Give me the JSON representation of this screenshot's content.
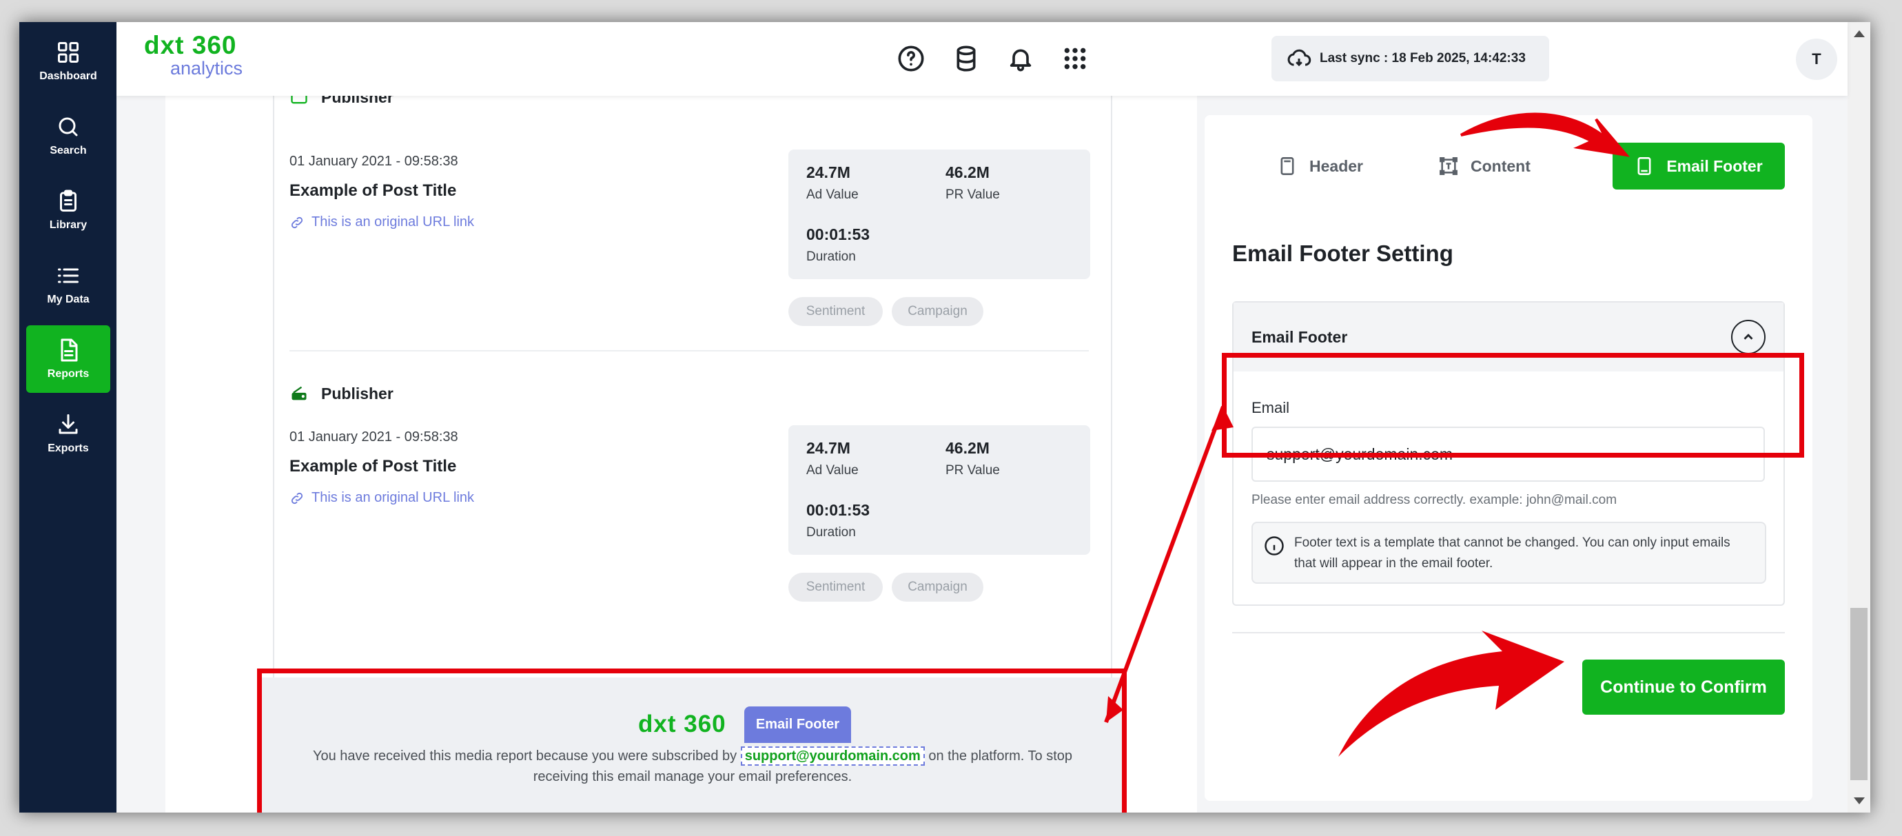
{
  "sidebar": {
    "items": [
      {
        "label": "Dashboard",
        "icon": "grid-icon"
      },
      {
        "label": "Search",
        "icon": "search-icon"
      },
      {
        "label": "Library",
        "icon": "clipboard-icon"
      },
      {
        "label": "My Data",
        "icon": "list-icon"
      },
      {
        "label": "Reports",
        "icon": "report-icon",
        "active": true
      },
      {
        "label": "Exports",
        "icon": "download-icon"
      }
    ]
  },
  "header": {
    "logo_brand": "dxt 360",
    "logo_sub": "analytics",
    "sync": "Last sync : 18 Feb 2025, 14:42:33",
    "avatar": "T",
    "icons": [
      "help-icon",
      "database-icon",
      "bell-icon",
      "apps-icon"
    ]
  },
  "preview": {
    "posts": [
      {
        "publisher": "Publisher",
        "date": "01 January 2021 - 09:58:38",
        "title": "Example of Post Title",
        "link": "This is an original URL link",
        "ad_value": "24.7M",
        "ad_label": "Ad Value",
        "pr_value": "46.2M",
        "pr_label": "PR Value",
        "duration": "00:01:53",
        "duration_label": "Duration",
        "tags": [
          "Sentiment",
          "Campaign"
        ]
      },
      {
        "publisher": "Publisher",
        "date": "01 January 2021 - 09:58:38",
        "title": "Example of Post Title",
        "link": "This is an original URL link",
        "ad_value": "24.7M",
        "ad_label": "Ad Value",
        "pr_value": "46.2M",
        "pr_label": "PR Value",
        "duration": "00:01:53",
        "duration_label": "Duration",
        "tags": [
          "Sentiment",
          "Campaign"
        ]
      }
    ],
    "footer": {
      "logo": "dxt 360",
      "tag": "Email Footer",
      "text_before": "You have received this media report because you were subscribed by",
      "email": "support@yourdomain.com",
      "text_after": "on the platform. To stop receiving this email manage your email preferences."
    }
  },
  "settings": {
    "tabs": [
      "Header",
      "Content",
      "Email Footer"
    ],
    "active_tab": "Email Footer",
    "title": "Email Footer Setting",
    "accordion_title": "Email Footer",
    "email_label": "Email",
    "email_value": "support@yourdomain.com",
    "email_help": "Please enter email address correctly. example: john@mail.com",
    "info": "Footer text is a template that cannot be changed. You can only input emails that will appear in the email footer.",
    "confirm": "Continue to Confirm"
  },
  "colors": {
    "brand_green": "#11b320",
    "accent_purple": "#6d7bdd",
    "sidebar_bg": "#0f1f3a",
    "annotation_red": "#e5000a"
  }
}
